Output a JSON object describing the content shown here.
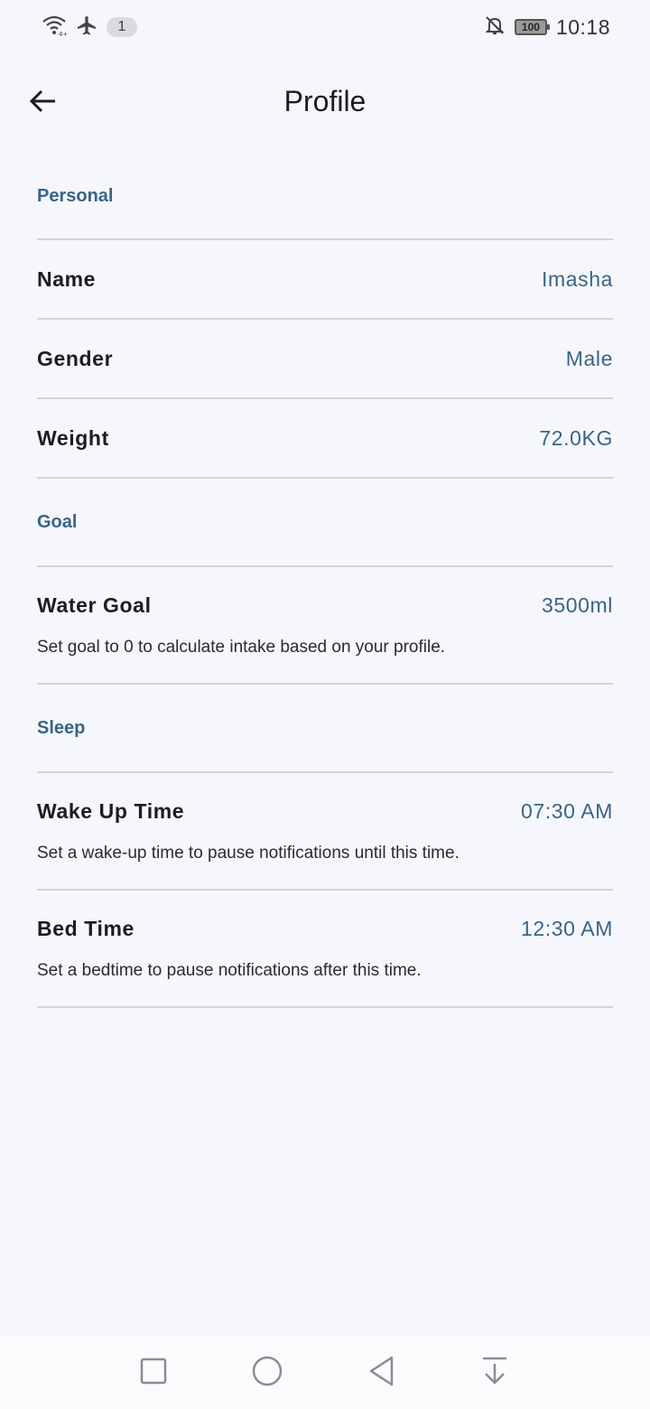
{
  "status_bar": {
    "notification_count": "1",
    "battery_level": "100",
    "time": "10:18",
    "icons": [
      "wifi-icon",
      "airplane-mode-icon",
      "notifications-off-icon",
      "battery-icon"
    ]
  },
  "app_bar": {
    "title": "Profile",
    "back_icon": "arrow-back-icon"
  },
  "sections": {
    "personal": {
      "header": "Personal",
      "name": {
        "label": "Name",
        "value": "Imasha"
      },
      "gender": {
        "label": "Gender",
        "value": "Male"
      },
      "weight": {
        "label": "Weight",
        "value": "72.0KG"
      }
    },
    "goal": {
      "header": "Goal",
      "water_goal": {
        "label": "Water Goal",
        "value": "3500ml",
        "description": "Set goal to 0 to calculate intake based on your profile."
      }
    },
    "sleep": {
      "header": "Sleep",
      "wake_up": {
        "label": "Wake Up Time",
        "value": "07:30 AM",
        "description": "Set a wake-up time to pause notifications until this time."
      },
      "bed_time": {
        "label": "Bed Time",
        "value": "12:30 AM",
        "description": "Set a bedtime to pause notifications after this time."
      }
    }
  },
  "nav_bar": {
    "icons": [
      "recents-square-icon",
      "home-circle-icon",
      "back-triangle-icon",
      "notification-shade-icon"
    ]
  },
  "colors": {
    "background": "#f5f7fc",
    "accent": "#3a6485",
    "divider": "#d2d4d9",
    "text_primary": "#1c1d22"
  }
}
